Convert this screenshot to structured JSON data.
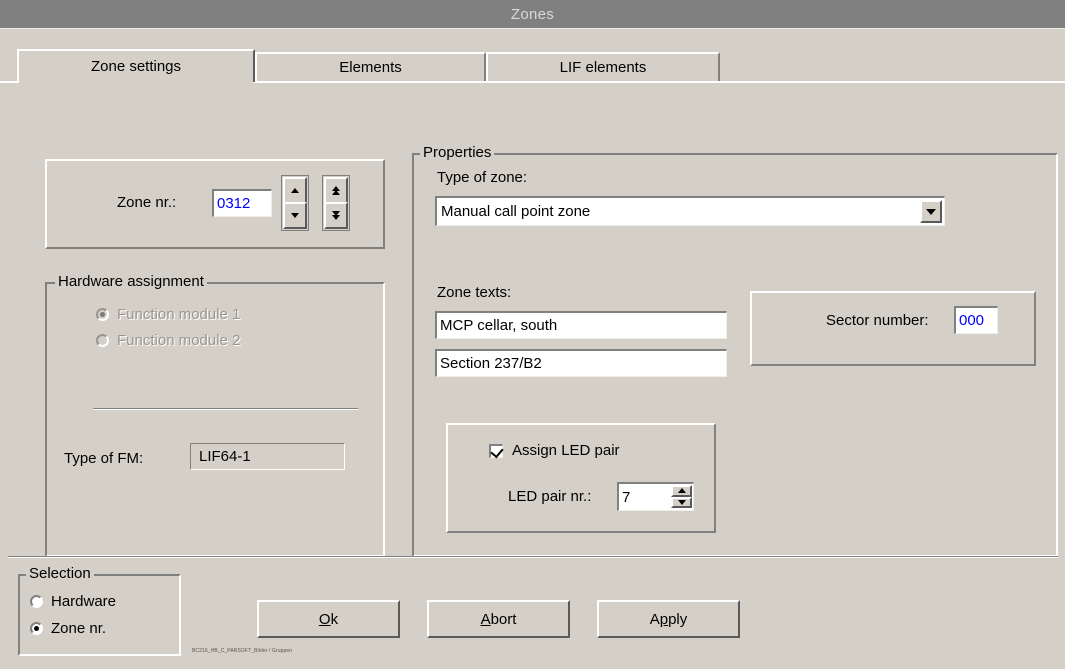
{
  "window": {
    "title": "Zones"
  },
  "tabs": [
    {
      "label": "Zone settings",
      "active": true
    },
    {
      "label": "Elements",
      "active": false
    },
    {
      "label": "LIF elements",
      "active": false
    }
  ],
  "zone_number_panel": {
    "label": "Zone nr.:",
    "value": "0312",
    "value_color": "#0000ff",
    "spinner_single": {
      "up_icon": "triangle-up-icon",
      "down_icon": "triangle-down-icon"
    },
    "spinner_double": {
      "up_icon": "double-triangle-up-icon",
      "down_icon": "double-triangle-down-icon"
    }
  },
  "hardware_assignment": {
    "title": "Hardware assignment",
    "disabled": true,
    "options": [
      {
        "label": "Function module 1",
        "selected": true
      },
      {
        "label": "Function module 2",
        "selected": false
      }
    ],
    "type_of_fm": {
      "label": "Type of FM:",
      "value": "LIF64-1"
    }
  },
  "properties": {
    "title": "Properties",
    "type_of_zone": {
      "label": "Type of zone:",
      "value": "Manual call point zone",
      "dropdown_icon": "chevron-down-icon"
    },
    "zone_texts": {
      "label": "Zone texts:",
      "line1": "MCP cellar, south",
      "line2": "Section 237/B2"
    },
    "sector": {
      "label": "Sector number:",
      "value": "000",
      "value_color": "#0000ff"
    },
    "led_pair": {
      "checkbox_label": "Assign LED pair",
      "checked": true,
      "number_label": "LED pair nr.:",
      "number_value": "7"
    }
  },
  "selection": {
    "title": "Selection",
    "options": [
      {
        "label": "Hardware",
        "selected": false
      },
      {
        "label": "Zone nr.",
        "selected": true
      }
    ]
  },
  "buttons": [
    {
      "pre": "",
      "accel": "O",
      "post": "k"
    },
    {
      "pre": "",
      "accel": "A",
      "post": "bort"
    },
    {
      "pre": "A",
      "accel": "p",
      "post": "ply"
    }
  ],
  "watermark": "BC216_HB_C_PARSOFT_Bilder / Gruppen",
  "colors": {
    "face": "#d4d0c8",
    "titlebar": "#808080",
    "titlebar_text": "#d8d8d8",
    "field_text_blue": "#0000ff",
    "disabled_text": "#9a968f"
  }
}
